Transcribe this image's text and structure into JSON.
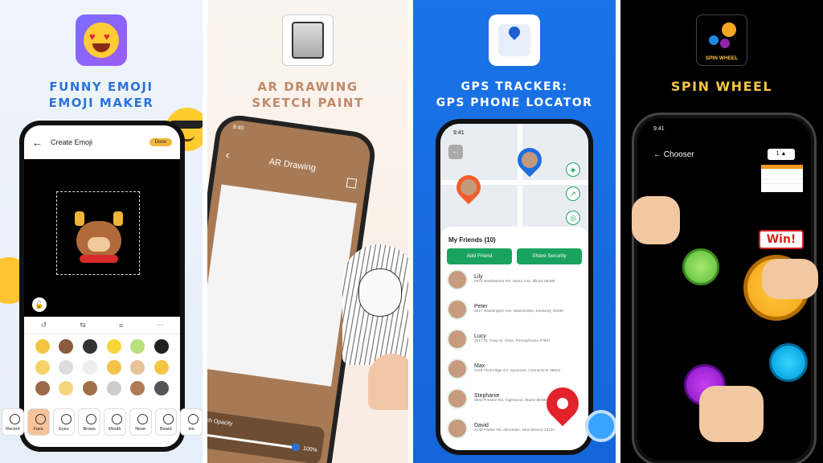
{
  "panels": {
    "emoji": {
      "headline_line1": "FUNNY EMOJI",
      "headline_line2": "EMOJI MAKER",
      "screen_title": "Create Emoji",
      "done_label": "Done",
      "categories": [
        "Recent",
        "Face",
        "Eyes",
        "Brows",
        "Mouth",
        "Nose",
        "Beard",
        "Ha"
      ],
      "active_category": "Face"
    },
    "drawing": {
      "headline_line1": "AR DRAWING",
      "headline_line2": "SKETCH PAINT",
      "time": "9:40",
      "screen_title": "AR Drawing",
      "opacity_label": "Sketch Opacity",
      "opacity_value": "100%"
    },
    "gps": {
      "headline_line1": "GPS TRACKER:",
      "headline_line2": "GPS PHONE LOCATOR",
      "time": "9:41",
      "friends_title": "My Friends (10)",
      "add_friend": "Add Friend",
      "share_security": "Share Security",
      "friends": [
        {
          "name": "Lily",
          "address": "2972 Westheimer Rd. Santa Ana, Illinois 85486"
        },
        {
          "name": "Peter",
          "address": "4517 Washington Ave. Manchester, Kentucky 39495"
        },
        {
          "name": "Lucy",
          "address": "3517 W. Gray St. Utica, Pennsylvania 57867"
        },
        {
          "name": "Max",
          "address": "2118 Thornridge Cir. Syracuse, Connecticut 35624"
        },
        {
          "name": "Stephanie",
          "address": "8502 Preston Rd. Inglewood, Maine 98380"
        },
        {
          "name": "David",
          "address": "4140 Parker Rd. Allentown, New Mexico 31134"
        }
      ]
    },
    "spin": {
      "headline": "SPIN WHEEL",
      "logo_text": "SPIN WHEEL",
      "time": "9:41",
      "screen_title": "Chooser",
      "count": "1",
      "win_label": "Win!"
    }
  },
  "colors": {
    "emoji_headline": "#2a73d9",
    "drawing_headline": "#c08a6a",
    "gps_bg": "#1a73e8",
    "gps_button": "#1aa35f",
    "spin_headline": "#f5c542"
  }
}
